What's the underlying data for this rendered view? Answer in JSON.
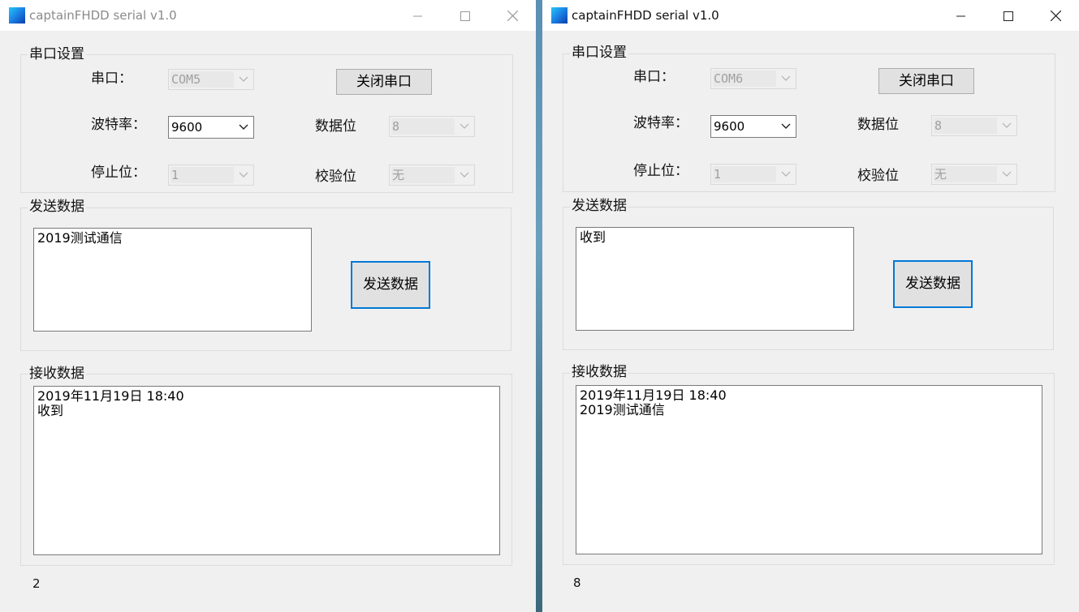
{
  "windows": [
    {
      "title": "captainFHDD serial v1.0",
      "serial_group": {
        "legend": "串口设置",
        "port_label": "串口：",
        "port_value": "COM5",
        "close_port_button": "关闭串口",
        "baud_label": "波特率：",
        "baud_value": "9600",
        "data_bits_label": "数据位",
        "data_bits_value": "8",
        "stop_bits_label": "停止位：",
        "stop_bits_value": "1",
        "parity_label": "校验位",
        "parity_value": "无"
      },
      "send_group": {
        "legend": "发送数据",
        "text": "2019测试通信",
        "button": "发送数据"
      },
      "receive_group": {
        "legend": "接收数据",
        "text": "2019年11月19日 18:40\n收到"
      },
      "count": "2"
    },
    {
      "title": "captainFHDD serial v1.0",
      "serial_group": {
        "legend": "串口设置",
        "port_label": "串口：",
        "port_value": "COM6",
        "close_port_button": "关闭串口",
        "baud_label": "波特率：",
        "baud_value": "9600",
        "data_bits_label": "数据位",
        "data_bits_value": "8",
        "stop_bits_label": "停止位：",
        "stop_bits_value": "1",
        "parity_label": "校验位",
        "parity_value": "无"
      },
      "send_group": {
        "legend": "发送数据",
        "text": "收到",
        "button": "发送数据"
      },
      "receive_group": {
        "legend": "接收数据",
        "text": "2019年11月19日 18:40\n2019测试通信"
      },
      "count": "8"
    }
  ]
}
